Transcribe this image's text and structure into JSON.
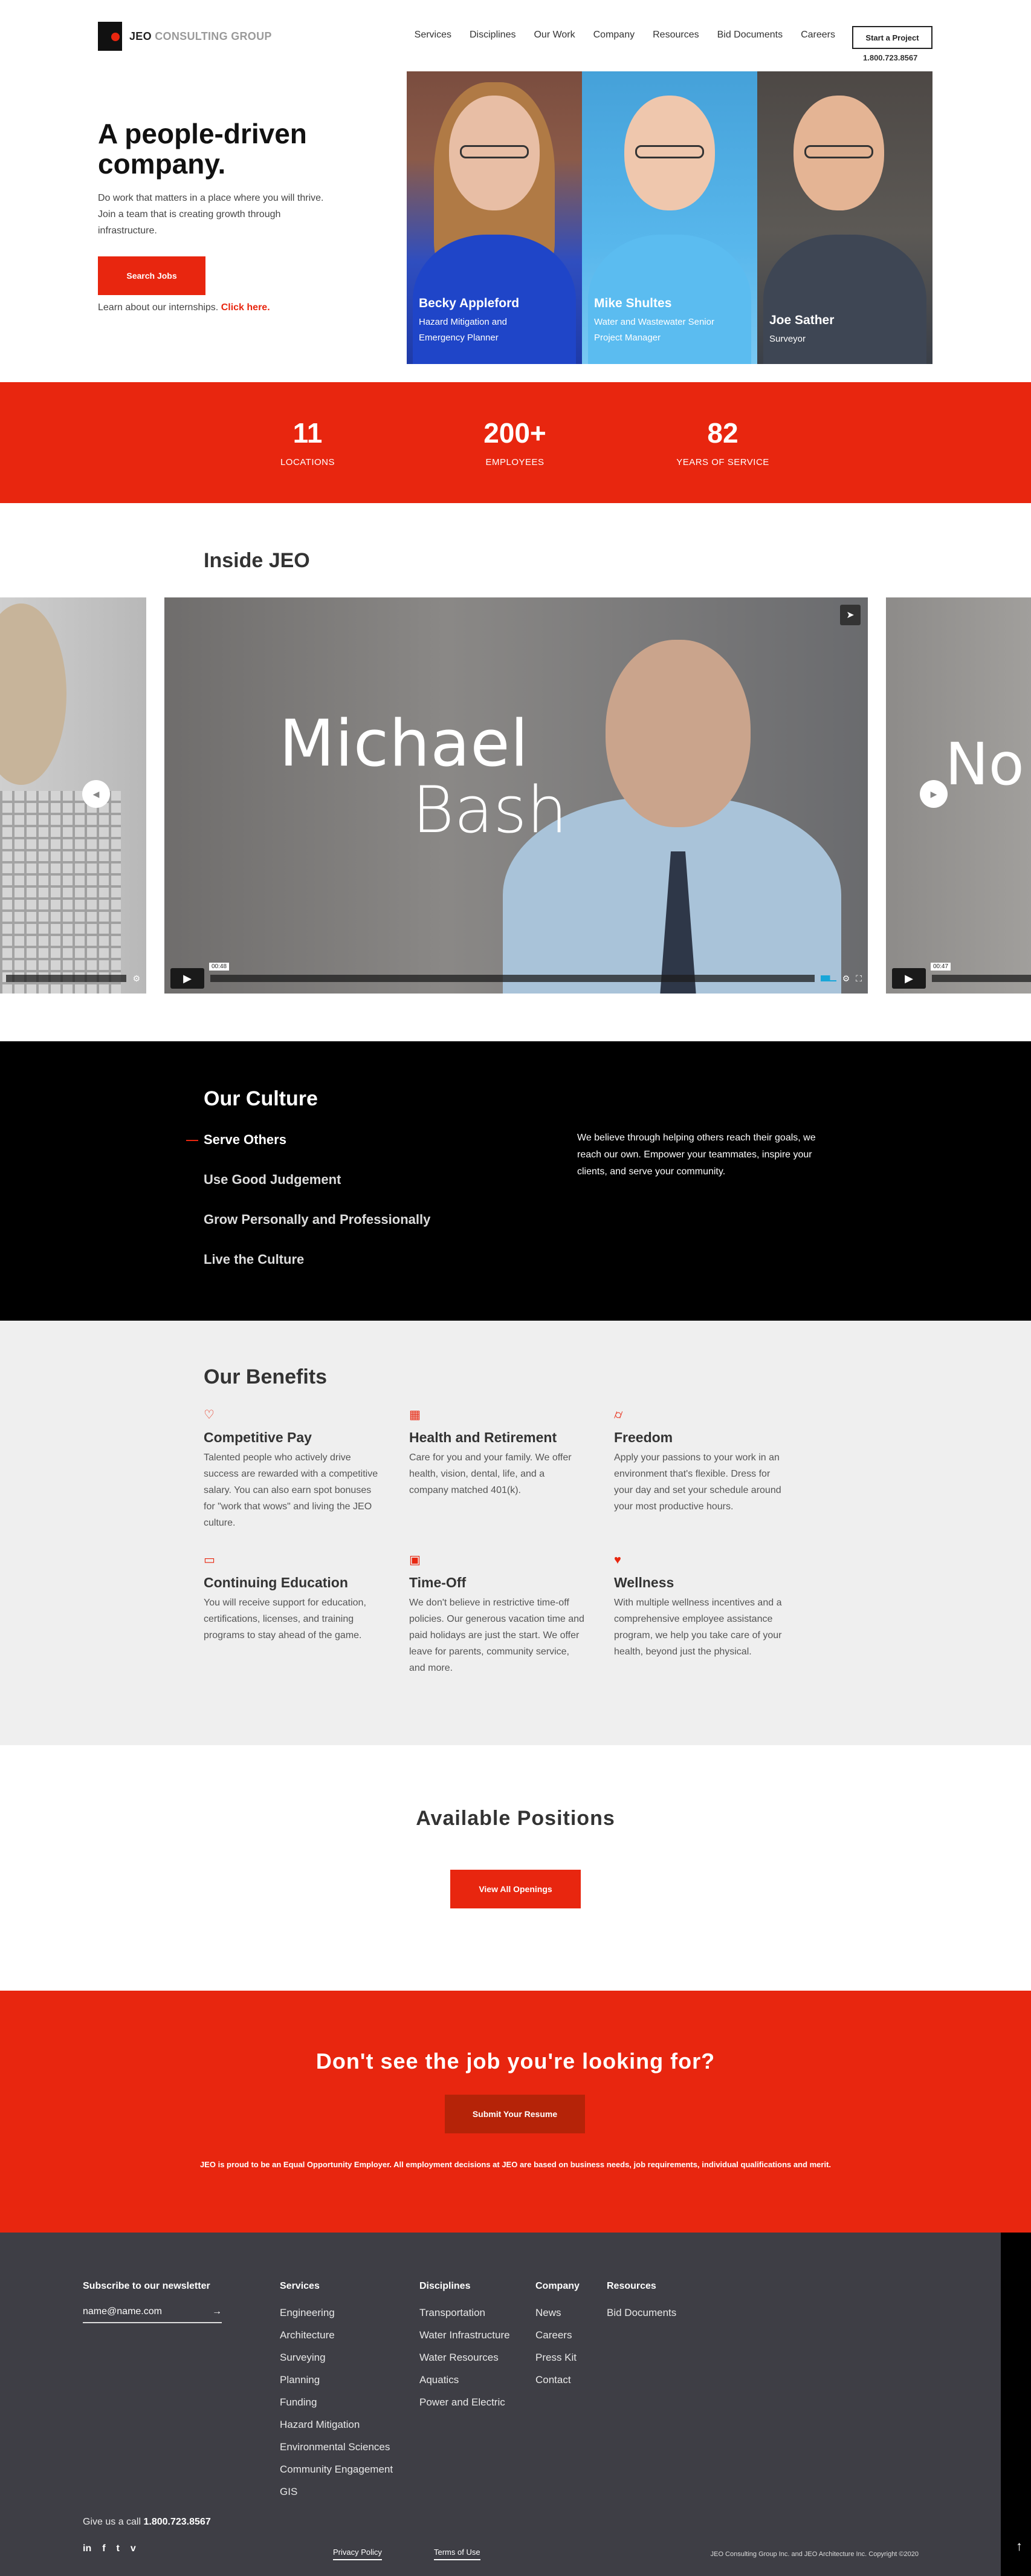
{
  "header": {
    "logo": {
      "brand": "JEO",
      "rest": "CONSULTING GROUP"
    },
    "nav": [
      "Services",
      "Disciplines",
      "Our Work",
      "Company",
      "Resources",
      "Bid Documents",
      "Careers"
    ],
    "cta_label": "Start a Project",
    "phone": "1.800.723.8567"
  },
  "hero": {
    "title": "A people-driven company.",
    "text": "Do work that matters in a place where you will thrive. Join a team that is creating growth through infrastructure.",
    "button": "Search Jobs",
    "intern_text": "Learn about our internships.",
    "intern_link": "Click here.",
    "people": [
      {
        "name": "Becky Appleford",
        "role": "Hazard Mitigation and Emergency Planner"
      },
      {
        "name": "Mike Shultes",
        "role": "Water and Wastewater Senior Project Manager"
      },
      {
        "name": "Joe Sather",
        "role": "Surveyor"
      }
    ]
  },
  "stats": [
    {
      "value": "11",
      "label": "LOCATIONS"
    },
    {
      "value": "200+",
      "label": "EMPLOYEES"
    },
    {
      "value": "82",
      "label": "YEARS OF SERVICE"
    }
  ],
  "inside": {
    "title": "Inside JEO",
    "main_video": {
      "first": "Michael",
      "last": "Bash",
      "time": "00:48"
    },
    "right_video": {
      "partial_name": "No",
      "time": "00:47"
    }
  },
  "culture": {
    "title": "Our Culture",
    "items": [
      "Serve Others",
      "Use Good Judgement",
      "Grow Personally and Professionally",
      "Live the  Culture"
    ],
    "text": "We believe through helping others reach their goals, we reach our own. Empower your teammates, inspire your clients, and serve your community."
  },
  "benefits": {
    "title": "Our Benefits",
    "items": [
      {
        "icon": "piggy-bank-icon",
        "title": "Competitive Pay",
        "text": "Talented people who actively drive success are rewarded with a competitive salary. You can also earn spot bonuses for \"work that wows\" and living the JEO culture."
      },
      {
        "icon": "grid-icon",
        "title": "Health and Retirement",
        "text": "Care for you and your family. We offer health, vision, dental, life, and a company matched 401(k)."
      },
      {
        "icon": "glasses-icon",
        "title": "Freedom",
        "text": "Apply your passions to your work in an environment that's flexible. Dress for your day and set your schedule around your most productive hours."
      },
      {
        "icon": "book-icon",
        "title": "Continuing Education",
        "text": "You will receive support for education, certifications, licenses, and training programs to stay ahead of the game."
      },
      {
        "icon": "calendar-icon",
        "title": "Time-Off",
        "text": "We don't believe in restrictive time-off policies. Our generous vacation time and paid holidays are just the start. We offer leave for parents, community service, and more."
      },
      {
        "icon": "heart-icon",
        "title": "Wellness",
        "text": "With multiple wellness incentives and a comprehensive employee assistance program, we help you take care of your health, beyond just the physical."
      }
    ]
  },
  "positions": {
    "title": "Available Positions",
    "button": "View All Openings"
  },
  "dontsee": {
    "title": "Don't see the job you're looking for?",
    "button": "Submit Your Resume",
    "note": "JEO is proud to be an Equal Opportunity Employer. All employment decisions at JEO are based on business needs, job requirements, individual qualifications and merit."
  },
  "footer": {
    "newsletter_label": "Subscribe to our newsletter",
    "newsletter_placeholder": "name@name.com",
    "columns": [
      {
        "head": "Services",
        "links": [
          "Engineering",
          "Architecture",
          "Surveying",
          "Planning",
          "Funding",
          "Hazard Mitigation",
          "Environmental Sciences",
          "Community Engagement",
          "GIS"
        ]
      },
      {
        "head": "Disciplines",
        "links": [
          "Transportation",
          "Water Infrastructure",
          "Water Resources",
          "Aquatics",
          "Power and Electric"
        ]
      },
      {
        "head": "Company",
        "links": [
          "News",
          "Careers",
          "Press Kit",
          "Contact"
        ]
      },
      {
        "head": "Resources",
        "links": [
          "Bid Documents"
        ]
      }
    ],
    "call_text": "Give us a call",
    "call_number": "1.800.723.8567",
    "social": [
      "in",
      "f",
      "t",
      "v"
    ],
    "privacy": "Privacy Policy",
    "terms": "Terms of Use",
    "copyright": "JEO Consulting Group Inc. and JEO Architecture Inc. Copyright ©2020"
  },
  "colors": {
    "accent": "#e8260f",
    "footer": "#3e3e45"
  }
}
